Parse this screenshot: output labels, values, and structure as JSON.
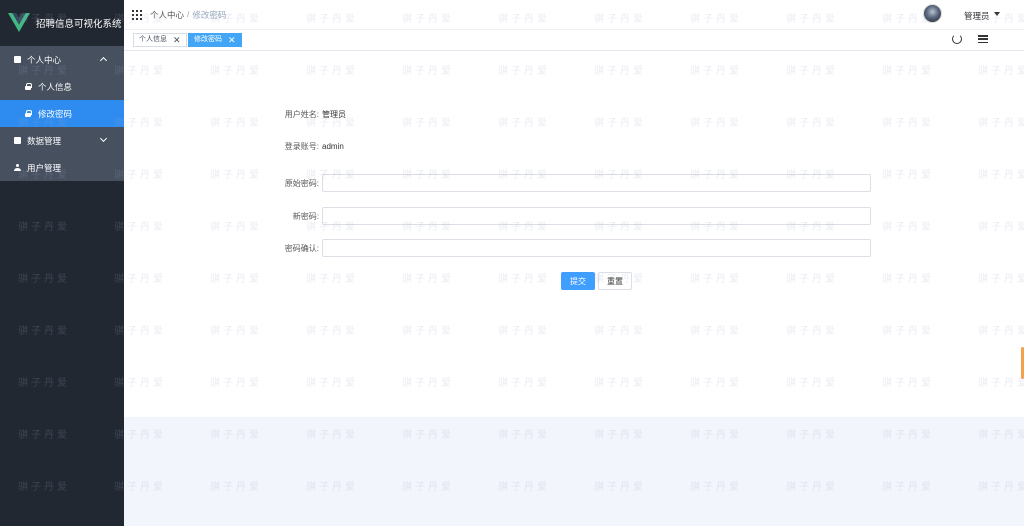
{
  "app": {
    "title": "招聘信息可视化系统"
  },
  "sidebar": {
    "items": [
      {
        "label": "个人中心",
        "icon": "square-icon",
        "expanded": true
      },
      {
        "label": "个人信息",
        "icon": "lock-icon"
      },
      {
        "label": "修改密码",
        "icon": "lock-icon",
        "active": true
      },
      {
        "label": "数据管理",
        "icon": "square-icon",
        "expanded": false
      },
      {
        "label": "用户管理",
        "icon": "user-icon"
      }
    ]
  },
  "header": {
    "breadcrumb": [
      "个人中心",
      "修改密码"
    ],
    "breadcrumb_sep": "/",
    "username": "管理员"
  },
  "tags": [
    {
      "label": "个人信息",
      "close": "✕"
    },
    {
      "label": "修改密码",
      "close": "✕",
      "active": true
    }
  ],
  "form": {
    "username_label": "用户姓名:",
    "username_value": "管理员",
    "account_label": "登录账号:",
    "account_value": "admin",
    "old_password_label": "原始密码:",
    "new_password_label": "新密码:",
    "confirm_password_label": "密码确认:",
    "submit_label": "提交",
    "reset_label": "重置"
  },
  "watermark": {
    "text": "骐子丹爱"
  },
  "colors": {
    "accent": "#409eff",
    "sidebar_bg": "#222831",
    "submenu_bg": "#46505f",
    "active_bg": "#2e8cf0",
    "tag_active": "#42a5f5"
  }
}
